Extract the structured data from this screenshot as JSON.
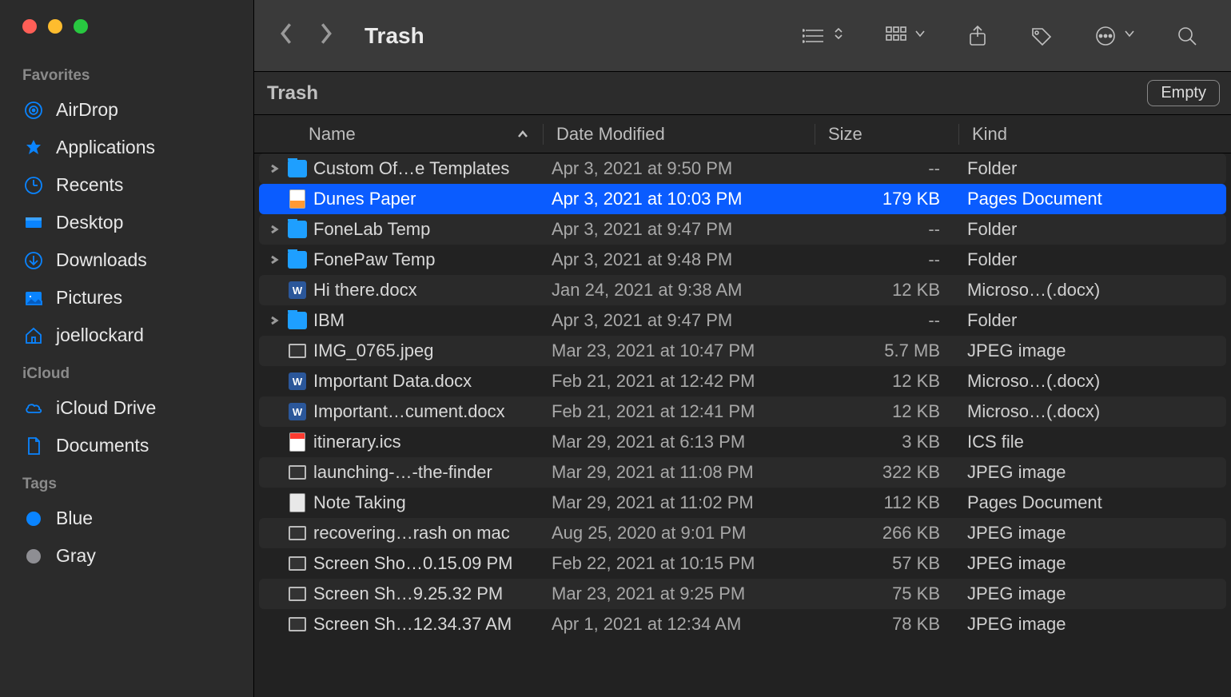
{
  "window": {
    "title": "Trash"
  },
  "path_bar": {
    "location": "Trash",
    "empty_label": "Empty"
  },
  "sidebar": {
    "sections": [
      {
        "label": "Favorites",
        "items": [
          {
            "label": "AirDrop",
            "icon": "airdrop"
          },
          {
            "label": "Applications",
            "icon": "applications"
          },
          {
            "label": "Recents",
            "icon": "recents"
          },
          {
            "label": "Desktop",
            "icon": "desktop"
          },
          {
            "label": "Downloads",
            "icon": "downloads"
          },
          {
            "label": "Pictures",
            "icon": "pictures"
          },
          {
            "label": "joellockard",
            "icon": "home"
          }
        ]
      },
      {
        "label": "iCloud",
        "items": [
          {
            "label": "iCloud Drive",
            "icon": "icloud"
          },
          {
            "label": "Documents",
            "icon": "documents"
          }
        ]
      },
      {
        "label": "Tags",
        "items": [
          {
            "label": "Blue",
            "icon": "tag",
            "color": "#0a84ff"
          },
          {
            "label": "Gray",
            "icon": "tag",
            "color": "#8e8e93"
          }
        ]
      }
    ]
  },
  "columns": {
    "name": "Name",
    "date": "Date Modified",
    "size": "Size",
    "kind": "Kind"
  },
  "rows": [
    {
      "expandable": true,
      "icon": "folder",
      "name": "Custom Of…e Templates",
      "date": "Apr 3, 2021 at 9:50 PM",
      "size": "--",
      "kind": "Folder"
    },
    {
      "expandable": false,
      "icon": "pages",
      "name": "Dunes Paper",
      "date": "Apr 3, 2021 at 10:03 PM",
      "size": "179 KB",
      "kind": "Pages Document",
      "selected": true
    },
    {
      "expandable": true,
      "icon": "folder",
      "name": "FoneLab Temp",
      "date": "Apr 3, 2021 at 9:47 PM",
      "size": "--",
      "kind": "Folder"
    },
    {
      "expandable": true,
      "icon": "folder",
      "name": "FonePaw Temp",
      "date": "Apr 3, 2021 at 9:48 PM",
      "size": "--",
      "kind": "Folder"
    },
    {
      "expandable": false,
      "icon": "word",
      "name": "Hi there.docx",
      "date": "Jan 24, 2021 at 9:38 AM",
      "size": "12 KB",
      "kind": "Microso…(.docx)"
    },
    {
      "expandable": true,
      "icon": "folder",
      "name": "IBM",
      "date": "Apr 3, 2021 at 9:47 PM",
      "size": "--",
      "kind": "Folder"
    },
    {
      "expandable": false,
      "icon": "image",
      "name": "IMG_0765.jpeg",
      "date": "Mar 23, 2021 at 10:47 PM",
      "size": "5.7 MB",
      "kind": "JPEG image"
    },
    {
      "expandable": false,
      "icon": "word",
      "name": "Important Data.docx",
      "date": "Feb 21, 2021 at 12:42 PM",
      "size": "12 KB",
      "kind": "Microso…(.docx)"
    },
    {
      "expandable": false,
      "icon": "word",
      "name": "Important…cument.docx",
      "date": "Feb 21, 2021 at 12:41 PM",
      "size": "12 KB",
      "kind": "Microso…(.docx)"
    },
    {
      "expandable": false,
      "icon": "ics",
      "name": "itinerary.ics",
      "date": "Mar 29, 2021 at 6:13 PM",
      "size": "3 KB",
      "kind": "ICS file"
    },
    {
      "expandable": false,
      "icon": "image",
      "name": "launching-…-the-finder",
      "date": "Mar 29, 2021 at 11:08 PM",
      "size": "322 KB",
      "kind": "JPEG image"
    },
    {
      "expandable": false,
      "icon": "doc",
      "name": "Note Taking",
      "date": "Mar 29, 2021 at 11:02 PM",
      "size": "112 KB",
      "kind": "Pages Document"
    },
    {
      "expandable": false,
      "icon": "image",
      "name": "recovering…rash on mac",
      "date": "Aug 25, 2020 at 9:01 PM",
      "size": "266 KB",
      "kind": "JPEG image"
    },
    {
      "expandable": false,
      "icon": "image",
      "name": "Screen Sho…0.15.09 PM",
      "date": "Feb 22, 2021 at 10:15 PM",
      "size": "57 KB",
      "kind": "JPEG image"
    },
    {
      "expandable": false,
      "icon": "image",
      "name": "Screen Sh…9.25.32 PM",
      "date": "Mar 23, 2021 at 9:25 PM",
      "size": "75 KB",
      "kind": "JPEG image"
    },
    {
      "expandable": false,
      "icon": "image",
      "name": "Screen Sh…12.34.37 AM",
      "date": "Apr 1, 2021 at 12:34 AM",
      "size": "78 KB",
      "kind": "JPEG image"
    }
  ]
}
